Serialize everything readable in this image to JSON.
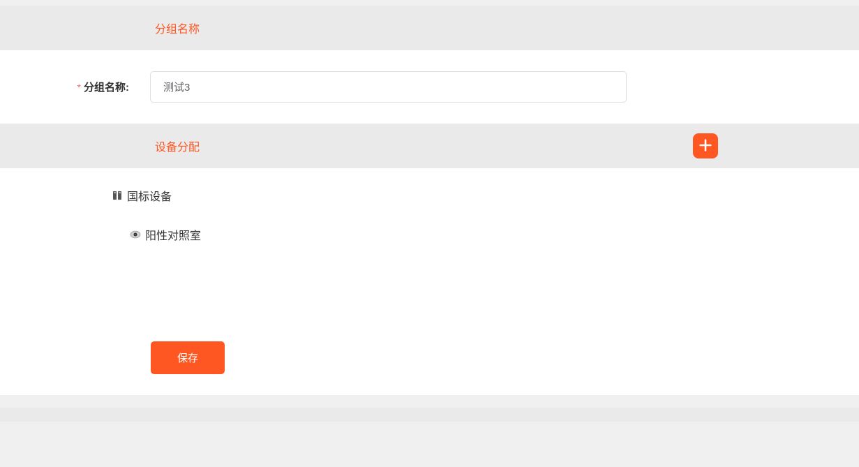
{
  "sections": {
    "group_name": {
      "title": "分组名称",
      "field_label": "分组名称:",
      "field_value": "测试3"
    },
    "device_assign": {
      "title": "设备分配",
      "tree": {
        "root_label": "国标设备",
        "child_label": "阳性对照室"
      }
    }
  },
  "actions": {
    "save_label": "保存"
  }
}
